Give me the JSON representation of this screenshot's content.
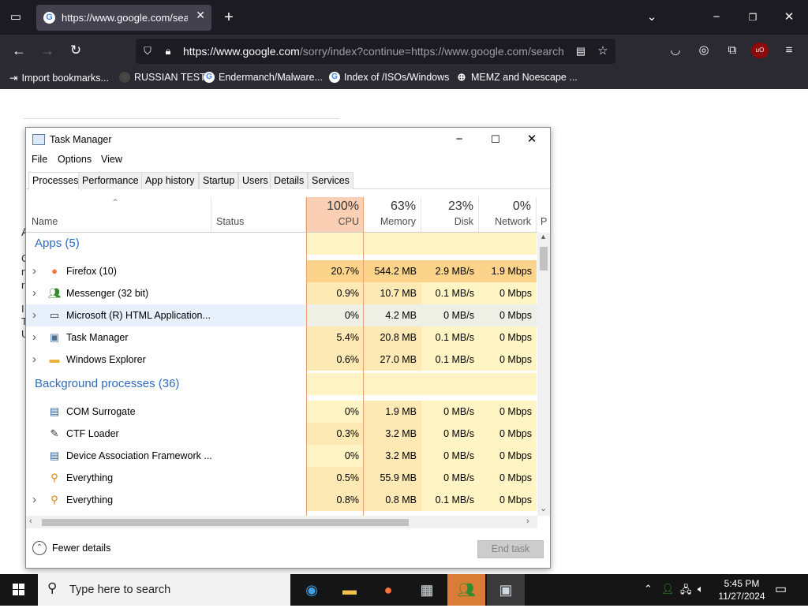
{
  "browser": {
    "tab_title": "https://www.google.com/search",
    "url_host": "https://www.google.com",
    "url_path": "/sorry/index?continue=https://www.google.com/search",
    "bookmarks": [
      "Import bookmarks...",
      "RUSSIAN TEST",
      "Endermanch/Malware...",
      "Index of /ISOs/Windows",
      "MEMZ and Noescape ..."
    ]
  },
  "page": {
    "bg_letters": [
      "A",
      "C",
      "n",
      "r",
      "U",
      "I",
      "T",
      "U"
    ]
  },
  "task_manager": {
    "title": "Task Manager",
    "menu": [
      "File",
      "Options",
      "View"
    ],
    "tabs": [
      "Processes",
      "Performance",
      "App history",
      "Startup",
      "Users",
      "Details",
      "Services"
    ],
    "columns": {
      "name": "Name",
      "status": "Status",
      "cpu": {
        "pct": "100%",
        "label": "CPU"
      },
      "memory": {
        "pct": "63%",
        "label": "Memory"
      },
      "disk": {
        "pct": "23%",
        "label": "Disk"
      },
      "network": {
        "pct": "0%",
        "label": "Network"
      },
      "power": "P"
    },
    "apps_header": "Apps (5)",
    "apps": [
      {
        "name": "Firefox (10)",
        "cpu": "20.7%",
        "mem": "544.2 MB",
        "disk": "2.9 MB/s",
        "net": "1.9 Mbps",
        "icon": "firefox-icon"
      },
      {
        "name": "Messenger (32 bit)",
        "cpu": "0.9%",
        "mem": "10.7 MB",
        "disk": "0.1 MB/s",
        "net": "0 Mbps",
        "icon": "messenger-icon"
      },
      {
        "name": "Microsoft (R) HTML Application...",
        "cpu": "0%",
        "mem": "4.2 MB",
        "disk": "0 MB/s",
        "net": "0 Mbps",
        "icon": "hta-window-icon"
      },
      {
        "name": "Task Manager",
        "cpu": "5.4%",
        "mem": "20.8 MB",
        "disk": "0.1 MB/s",
        "net": "0 Mbps",
        "icon": "task-manager-icon"
      },
      {
        "name": "Windows Explorer",
        "cpu": "0.6%",
        "mem": "27.0 MB",
        "disk": "0.1 MB/s",
        "net": "0 Mbps",
        "icon": "explorer-folder-icon"
      }
    ],
    "bg_header": "Background processes (36)",
    "background": [
      {
        "name": "COM Surrogate",
        "cpu": "0%",
        "mem": "1.9 MB",
        "disk": "0 MB/s",
        "net": "0 Mbps",
        "icon": "com-surrogate-icon"
      },
      {
        "name": "CTF Loader",
        "cpu": "0.3%",
        "mem": "3.2 MB",
        "disk": "0 MB/s",
        "net": "0 Mbps",
        "icon": "ctf-loader-icon"
      },
      {
        "name": "Device Association Framework ...",
        "cpu": "0%",
        "mem": "3.2 MB",
        "disk": "0 MB/s",
        "net": "0 Mbps",
        "icon": "device-association-icon"
      },
      {
        "name": "Everything",
        "cpu": "0.5%",
        "mem": "55.9 MB",
        "disk": "0 MB/s",
        "net": "0 Mbps",
        "icon": "everything-search-icon"
      },
      {
        "name": "Everything",
        "cpu": "0.8%",
        "mem": "0.8 MB",
        "disk": "0.1 MB/s",
        "net": "0 Mbps",
        "icon": "everything-search-icon"
      }
    ],
    "fewer_details": "Fewer details",
    "end_task": "End task"
  },
  "taskbar": {
    "search_placeholder": "Type here to search",
    "time": "5:45 PM",
    "date": "11/27/2024"
  },
  "colors": {
    "cpu_hot": "#fbd38a",
    "cpu_warm": "#fde9b4",
    "cell_light": "#fff4c4",
    "group_blue": "#2e6cc0"
  }
}
